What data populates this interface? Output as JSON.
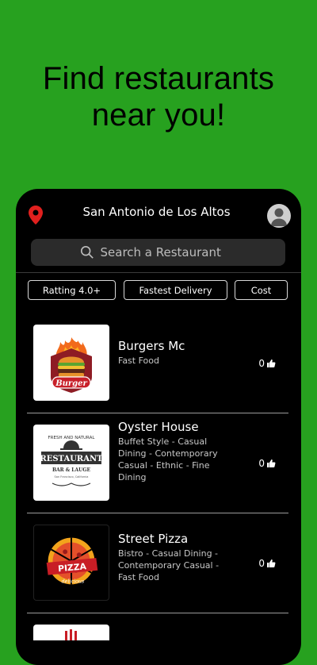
{
  "hero": {
    "line1": "Find restaurants",
    "line2": "near you!"
  },
  "header": {
    "location": "San Antonio de Los Altos"
  },
  "search": {
    "placeholder": "Search a Restaurant"
  },
  "filters": [
    {
      "label": "Ratting 4.0+"
    },
    {
      "label": "Fastest Delivery"
    },
    {
      "label": "Cost"
    }
  ],
  "restaurants": [
    {
      "name": "Burgers Mc",
      "category": "Fast Food",
      "likes": "0",
      "logo_text": "Burger"
    },
    {
      "name": "Oyster House",
      "category": "Buffet Style - Casual Dining - Contemporary Casual - Ethnic - Fine Dining",
      "likes": "0",
      "logo_top": "FRESH AND NATURAL",
      "logo_title": "RESTAURANT",
      "logo_sub": "BAR & LAUGE",
      "logo_small": "San Francisco, California"
    },
    {
      "name": "Street Pizza",
      "category": "Bistro - Casual Dining - Contemporary Casual - Fast Food",
      "likes": "0",
      "logo_title": "PIZZA",
      "logo_sub": "delicious"
    }
  ],
  "colors": {
    "background": "#27a11f",
    "phone": "#000000",
    "accent": "#e0201e"
  }
}
